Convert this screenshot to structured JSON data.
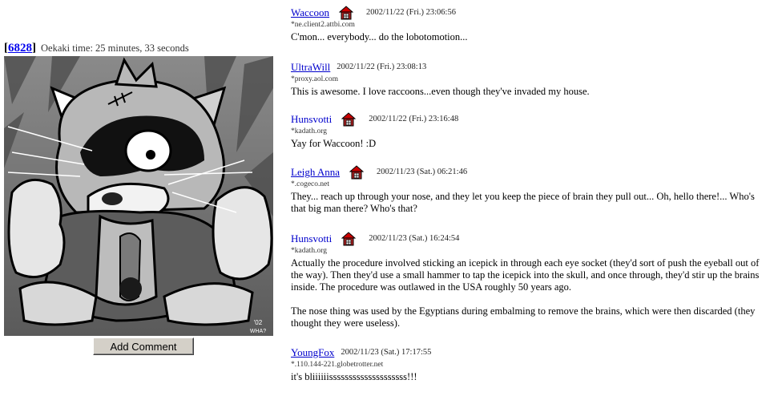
{
  "post": {
    "id": "6828",
    "oekaki_time": "Oekaki time: 25 minutes, 33 seconds",
    "signature": "'02 WHA?",
    "add_comment_label": "Add Comment"
  },
  "comments": [
    {
      "name": "Waccoon",
      "linked": true,
      "home": true,
      "date": "2002/11/22 (Fri.) 23:06:56",
      "host": "*ne.client2.attbi.com",
      "text": [
        "C'mon... everybody... do the lobotomotion..."
      ]
    },
    {
      "name": "UltraWill",
      "linked": true,
      "home": false,
      "date": "2002/11/22 (Fri.) 23:08:13",
      "host": "*proxy.aol.com",
      "text": [
        "This is awesome. I love raccoons...even though they've invaded my house."
      ]
    },
    {
      "name": "Hunsvotti",
      "linked": false,
      "home": true,
      "date": "2002/11/22 (Fri.) 23:16:48",
      "host": "*kadath.org",
      "text": [
        "Yay for Waccoon! :D"
      ]
    },
    {
      "name": "Leigh Anna",
      "linked": true,
      "home": true,
      "date": "2002/11/23 (Sat.) 06:21:46",
      "host": "*.cogeco.net",
      "text": [
        "They... reach up through your nose, and they let you keep the piece of brain they pull out... Oh, hello there!... Who's that big man there? Who's that?"
      ]
    },
    {
      "name": "Hunsvotti",
      "linked": false,
      "home": true,
      "date": "2002/11/23 (Sat.) 16:24:54",
      "host": "*kadath.org",
      "text": [
        "Actually the procedure involved sticking an icepick in through each eye socket (they'd sort of push the eyeball out of the way). Then they'd use a small hammer to tap the icepick into the skull, and once through, they'd stir up the brains inside. The procedure was outlawed in the USA roughly 50 years ago.",
        "The nose thing was used by the Egyptians during embalming to remove the brains, which were then discarded (they thought they were useless)."
      ]
    },
    {
      "name": "YoungFox",
      "linked": true,
      "home": false,
      "date": "2002/11/23 (Sat.) 17:17:55",
      "host": "*.110.144-221.globetrotter.net",
      "text": [
        "it's bliiiiiissssssssssssssssssss!!!"
      ]
    }
  ]
}
